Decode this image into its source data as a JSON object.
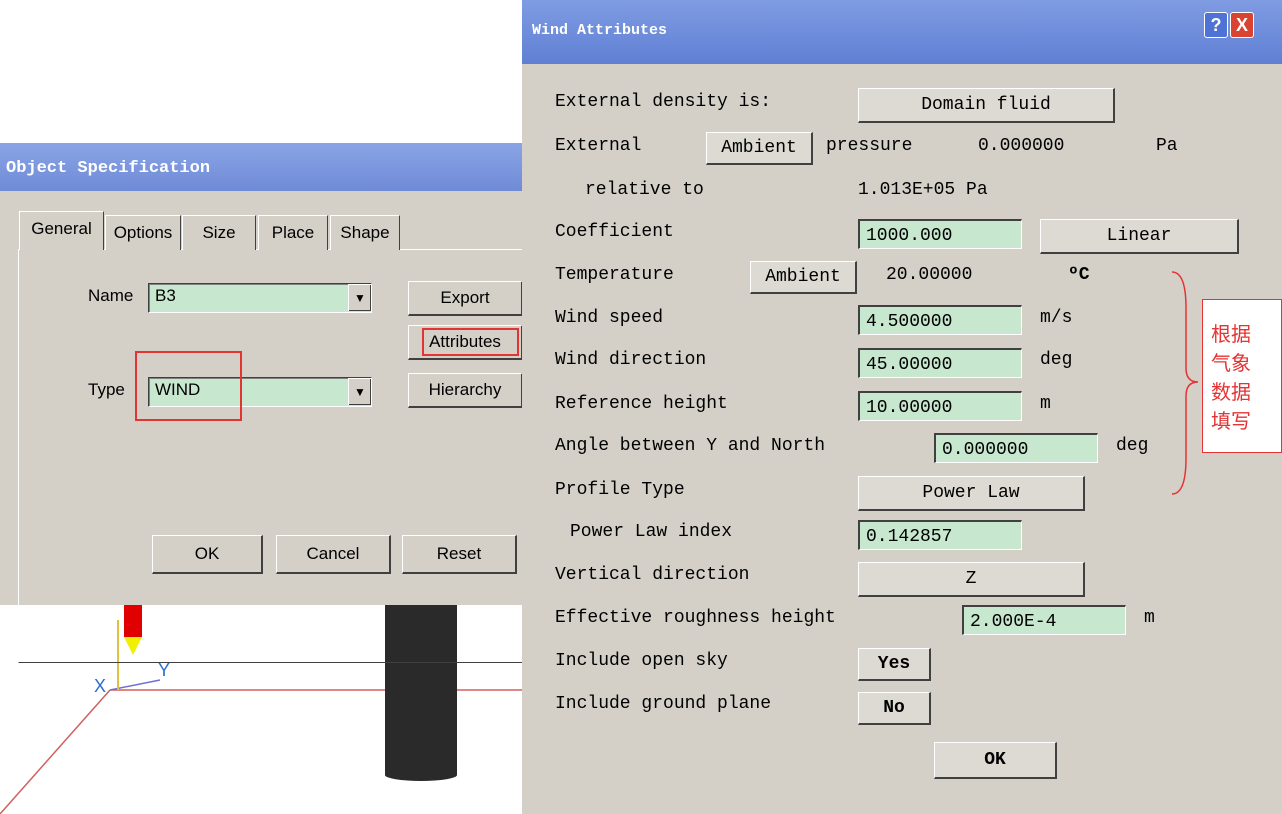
{
  "viewport": {
    "axis_y_label": "Y",
    "axis_x_label": "X"
  },
  "object_spec": {
    "title": "Object Specification",
    "tabs": [
      "General",
      "Options",
      "Size",
      "Place",
      "Shape"
    ],
    "name_label": "Name",
    "name_value": "B3",
    "type_label": "Type",
    "type_value": "WIND",
    "export_button": "Export",
    "attributes_button": "Attributes",
    "hierarchy_button": "Hierarchy",
    "ok_button": "OK",
    "cancel_button": "Cancel",
    "reset_button": "Reset"
  },
  "wind": {
    "title": "Wind Attributes",
    "help_button": "?",
    "close_button": "X",
    "ext_density_label": "External density is:",
    "ext_density_value": "Domain fluid",
    "external_label": "External",
    "ambient_pressure_button": "Ambient",
    "pressure_label": "pressure",
    "pressure_value": "0.000000",
    "pressure_unit": "Pa",
    "relative_to_label": "relative to",
    "relative_to_value": "1.013E+05 Pa",
    "coefficient_label": "Coefficient",
    "coefficient_value": "1000.000",
    "linear_button": "Linear",
    "temperature_label": "Temperature",
    "ambient_temp_button": "Ambient",
    "temperature_value": "20.00000",
    "temperature_unit": "ºC",
    "wind_speed_label": "Wind speed",
    "wind_speed_value": "4.500000",
    "wind_speed_unit": "m/s",
    "wind_direction_label": "Wind direction",
    "wind_direction_value": "45.00000",
    "wind_direction_unit": "deg",
    "ref_height_label": "Reference height",
    "ref_height_value": "10.00000",
    "ref_height_unit": "m",
    "angle_label": "Angle between Y and North",
    "angle_value": "0.000000",
    "angle_unit": "deg",
    "profile_type_label": "Profile Type",
    "profile_type_value": "Power Law",
    "power_law_index_label": "Power Law index",
    "power_law_index_value": "0.142857",
    "vertical_dir_label": "Vertical direction",
    "vertical_dir_value": "Z",
    "roughness_label": "Effective roughness height",
    "roughness_value": "2.000E-4",
    "roughness_unit": "m",
    "open_sky_label": "Include open sky",
    "open_sky_value": "Yes",
    "ground_plane_label": "Include ground plane",
    "ground_plane_value": "No",
    "ok_button": "OK"
  },
  "annotation": {
    "lines": [
      "根据",
      "气象",
      "数据",
      "填写"
    ],
    "color": "#e53333"
  }
}
